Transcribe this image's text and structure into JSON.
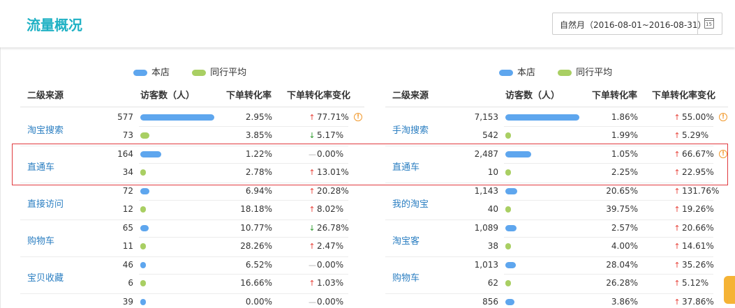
{
  "header": {
    "title": "流量概况",
    "date_range": "自然月（2016-08-01~2016-08-31）",
    "calendar_day": "15"
  },
  "legend": {
    "shop": "本店",
    "peer": "同行平均"
  },
  "colors": {
    "shop": "#5ea6ee",
    "peer": "#a9cf63",
    "brand": "#1fb1c4",
    "link": "#2c7fc2",
    "up": "#e8453c",
    "down": "#2e9b2e"
  },
  "columns": {
    "source": "二级来源",
    "visitors": "访客数（人）",
    "rate": "下单转化率",
    "change": "下单转化率变化"
  },
  "left": {
    "rows": [
      {
        "name": "淘宝搜索",
        "shop": {
          "visitors": "577",
          "rate": "2.95%",
          "change": "77.71%",
          "dir": "up"
        },
        "peer": {
          "visitors": "73",
          "rate": "3.85%",
          "change": "5.17%",
          "dir": "down"
        },
        "warn": true
      },
      {
        "name": "直通车",
        "shop": {
          "visitors": "164",
          "rate": "1.22%",
          "change": "0.00%",
          "dir": "flat"
        },
        "peer": {
          "visitors": "34",
          "rate": "2.78%",
          "change": "13.01%",
          "dir": "up"
        }
      },
      {
        "name": "直接访问",
        "shop": {
          "visitors": "72",
          "rate": "6.94%",
          "change": "20.28%",
          "dir": "up"
        },
        "peer": {
          "visitors": "12",
          "rate": "18.18%",
          "change": "8.02%",
          "dir": "up"
        }
      },
      {
        "name": "购物车",
        "shop": {
          "visitors": "65",
          "rate": "10.77%",
          "change": "26.78%",
          "dir": "down"
        },
        "peer": {
          "visitors": "11",
          "rate": "28.26%",
          "change": "2.47%",
          "dir": "up"
        }
      },
      {
        "name": "宝贝收藏",
        "shop": {
          "visitors": "46",
          "rate": "6.52%",
          "change": "0.00%",
          "dir": "flat"
        },
        "peer": {
          "visitors": "6",
          "rate": "16.66%",
          "change": "1.03%",
          "dir": "up"
        }
      },
      {
        "name": "",
        "shop": {
          "visitors": "39",
          "rate": "0.00%",
          "change": "0.00%",
          "dir": "flat"
        },
        "peer": null
      }
    ]
  },
  "right": {
    "rows": [
      {
        "name": "手淘搜索",
        "shop": {
          "visitors": "7,153",
          "rate": "1.86%",
          "change": "55.00%",
          "dir": "up"
        },
        "peer": {
          "visitors": "542",
          "rate": "1.99%",
          "change": "5.29%",
          "dir": "up"
        },
        "warn": true
      },
      {
        "name": "直通车",
        "shop": {
          "visitors": "2,487",
          "rate": "1.05%",
          "change": "66.67%",
          "dir": "up"
        },
        "peer": {
          "visitors": "10",
          "rate": "2.25%",
          "change": "22.95%",
          "dir": "up"
        },
        "warn": true
      },
      {
        "name": "我的淘宝",
        "shop": {
          "visitors": "1,143",
          "rate": "20.65%",
          "change": "131.76%",
          "dir": "up"
        },
        "peer": {
          "visitors": "40",
          "rate": "39.75%",
          "change": "19.26%",
          "dir": "up"
        }
      },
      {
        "name": "淘宝客",
        "shop": {
          "visitors": "1,089",
          "rate": "2.57%",
          "change": "20.66%",
          "dir": "up"
        },
        "peer": {
          "visitors": "38",
          "rate": "4.00%",
          "change": "14.61%",
          "dir": "up"
        }
      },
      {
        "name": "购物车",
        "shop": {
          "visitors": "1,013",
          "rate": "28.04%",
          "change": "35.26%",
          "dir": "up"
        },
        "peer": {
          "visitors": "62",
          "rate": "26.28%",
          "change": "5.12%",
          "dir": "up"
        }
      },
      {
        "name": "",
        "shop": {
          "visitors": "856",
          "rate": "3.86%",
          "change": "37.86%",
          "dir": "up"
        },
        "peer": null
      }
    ]
  }
}
